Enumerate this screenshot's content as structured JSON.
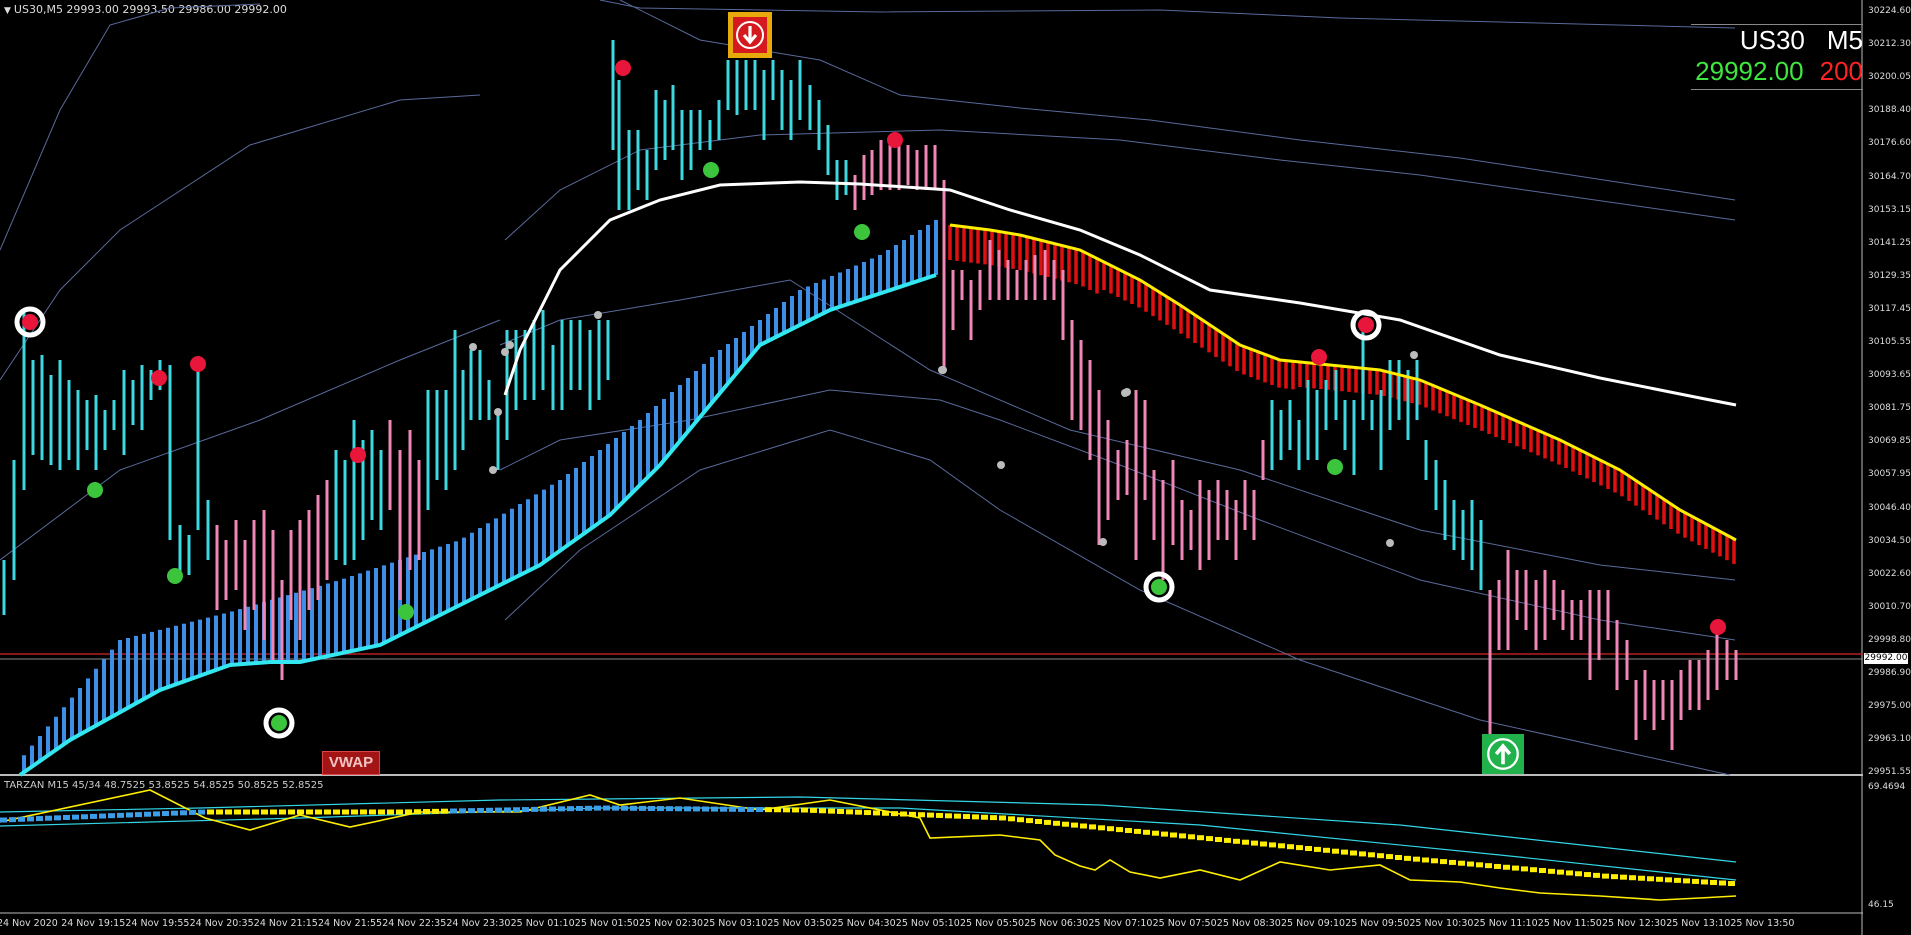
{
  "window": {
    "header": "US30,M5  29993.00 29993.50 29986.00 29992.00"
  },
  "panel": {
    "symbol": "US30",
    "timeframe": "M5",
    "price": "29992.00",
    "spread": "200"
  },
  "indicator_header": "TARZAN M15 45/34 48.7525 53.8525 54.8525 50.8525 52.8525",
  "vwap_label": "VWAP",
  "current_price_tag": "29992.00",
  "price_axis": [
    "30224.60",
    "30212.30",
    "30200.05",
    "30188.40",
    "30176.60",
    "30164.70",
    "30153.15",
    "30141.25",
    "30129.35",
    "30117.45",
    "30105.55",
    "30093.65",
    "30081.75",
    "30069.85",
    "30057.95",
    "30046.40",
    "30034.50",
    "30022.60",
    "30010.70",
    "29998.80",
    "29986.90",
    "29975.00",
    "29963.10",
    "29951.55"
  ],
  "indicator_axis": [
    "69.4694",
    "46.15"
  ],
  "time_axis": [
    "24 Nov 2020",
    "24 Nov 19:15",
    "24 Nov 19:55",
    "24 Nov 20:35",
    "24 Nov 21:15",
    "24 Nov 21:55",
    "24 Nov 22:35",
    "24 Nov 23:30",
    "25 Nov 01:10",
    "25 Nov 01:50",
    "25 Nov 02:30",
    "25 Nov 03:10",
    "25 Nov 03:50",
    "25 Nov 04:30",
    "25 Nov 05:10",
    "25 Nov 05:50",
    "25 Nov 06:30",
    "25 Nov 07:10",
    "25 Nov 07:50",
    "25 Nov 08:30",
    "25 Nov 09:10",
    "25 Nov 09:50",
    "25 Nov 10:30",
    "25 Nov 11:10",
    "25 Nov 11:50",
    "25 Nov 12:30",
    "25 Nov 13:10",
    "25 Nov 13:50"
  ],
  "signals": {
    "sell_arrow": "arrow-down-icon",
    "buy_arrow": "arrow-up-icon"
  },
  "colors": {
    "bull_bar": "#3ed9e0",
    "bear_bar": "#f087b8",
    "cloud_up": "#3c8ee6",
    "cloud_down": "#e01010",
    "ma_cyan": "#33e6f0",
    "ma_white": "#ffffff",
    "ma_yellow": "#ffee00",
    "band": "#5a6a9a",
    "sell_dot": "#e8163b",
    "buy_dot": "#3cc43c",
    "price_line": "#b52020"
  }
}
